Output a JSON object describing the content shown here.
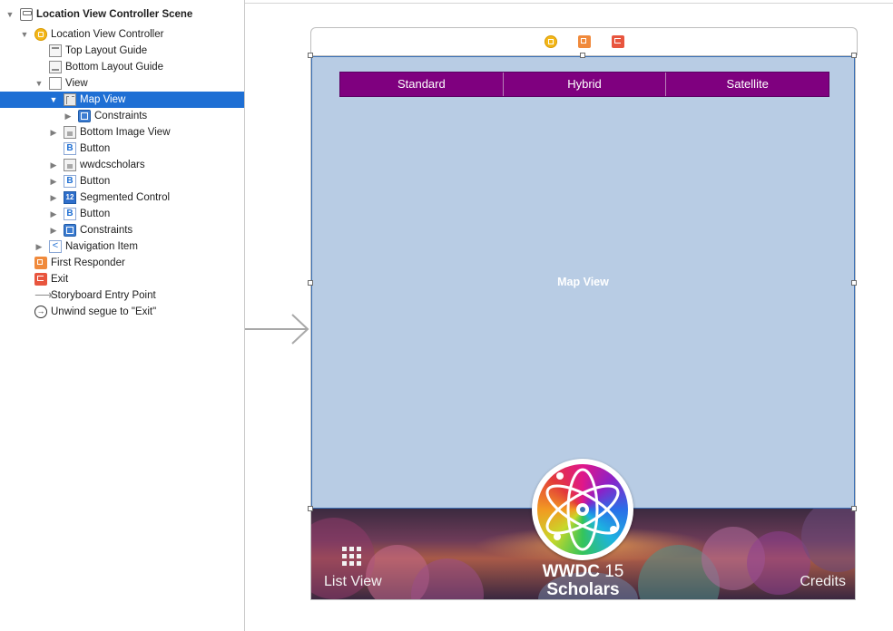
{
  "outline": {
    "rows": [
      {
        "label": "Location View Controller Scene"
      },
      {
        "label": "Location View Controller"
      },
      {
        "label": "Top Layout Guide"
      },
      {
        "label": "Bottom Layout Guide"
      },
      {
        "label": "View"
      },
      {
        "label": "Map View"
      },
      {
        "label": "Constraints"
      },
      {
        "label": "Bottom Image View"
      },
      {
        "label": "Button"
      },
      {
        "label": "wwdcscholars"
      },
      {
        "label": "Button"
      },
      {
        "label": "Segmented Control"
      },
      {
        "label": "Button"
      },
      {
        "label": "Constraints"
      },
      {
        "label": "Navigation Item"
      },
      {
        "label": "First Responder"
      },
      {
        "label": "Exit"
      },
      {
        "label": "Storyboard Entry Point"
      },
      {
        "label": "Unwind segue to \"Exit\""
      }
    ],
    "selected_label": "Map View",
    "selection_color": "#1e6fd4",
    "icons": {
      "button_glyph": "B",
      "segmented_glyph": "12",
      "navigation_glyph": "<",
      "unwind_glyph": "→"
    }
  },
  "canvas": {
    "map_view_label": "Map View",
    "map_view_color": "#b8cce4",
    "segmented_control": {
      "segments": [
        "Standard",
        "Hybrid",
        "Satellite"
      ],
      "tint": "#7f007f"
    },
    "bottom_bar": {
      "list_view_label": "List View",
      "credits_label": "Credits",
      "title_line1_prefix": "WWDC",
      "title_line1_number": "15",
      "title_line2": "Scholars"
    },
    "dock_icons": [
      "view-controller-icon",
      "first-responder-icon",
      "exit-icon"
    ]
  }
}
